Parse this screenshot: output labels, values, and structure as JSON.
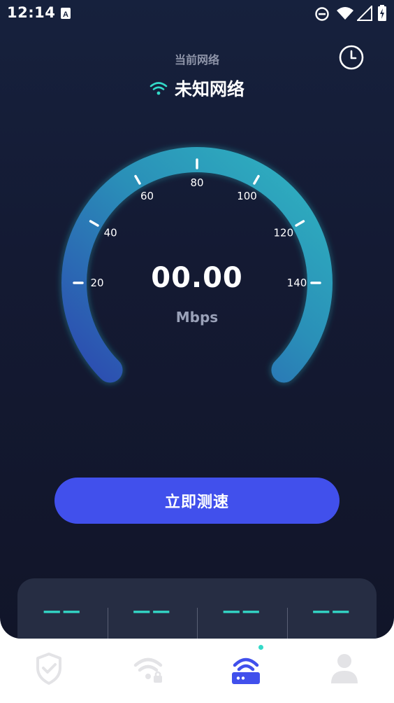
{
  "status_bar": {
    "time": "12:14",
    "icons": [
      "keyboard-a-icon",
      "do-not-disturb-icon",
      "wifi-icon",
      "signal-icon",
      "battery-charging-icon"
    ]
  },
  "header": {
    "network_label": "当前网络",
    "network_name": "未知网络",
    "history_icon": "clock-icon"
  },
  "gauge": {
    "tick_labels": [
      "20",
      "40",
      "60",
      "80",
      "100",
      "120",
      "140"
    ],
    "value": "00.00",
    "unit": "Mbps"
  },
  "actions": {
    "start_test_label": "立即测速"
  },
  "results": {
    "values": [
      "——",
      "——",
      "——",
      "——"
    ]
  },
  "nav": {
    "items": [
      {
        "icon": "shield-check-icon"
      },
      {
        "icon": "wifi-lock-icon"
      },
      {
        "icon": "router-icon",
        "active": true
      },
      {
        "icon": "user-icon"
      }
    ]
  },
  "colors": {
    "background": "#141a33",
    "accent": "#4150ec",
    "teal": "#33d9c8",
    "nav_inactive": "#e3e3e6"
  }
}
